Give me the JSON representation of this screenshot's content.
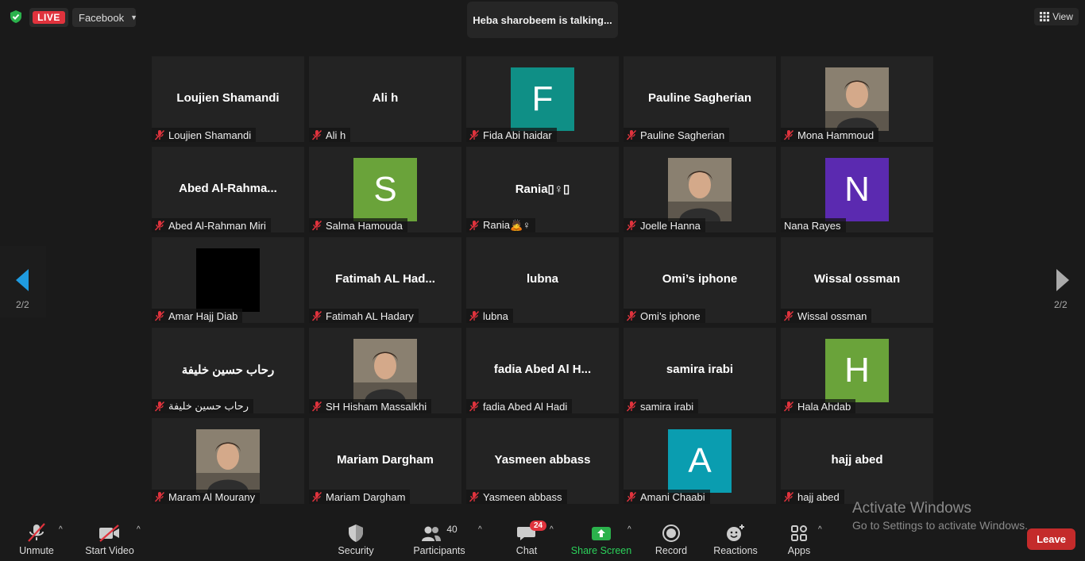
{
  "topbar": {
    "live_label": "LIVE",
    "stream_target": "Facebook",
    "talking": "Heba sharobeem is talking...",
    "view_label": "View"
  },
  "pagination": {
    "left": "2/2",
    "right": "2/2"
  },
  "colors": {
    "green": "#6aa33a",
    "purple": "#5b2ab0",
    "teal": "#0f8f86",
    "cyan": "#0a9db0",
    "live": "#e0333d",
    "share": "#2bb24c"
  },
  "participants": [
    {
      "display": "Loujien Shamandi",
      "label": "Loujien Shamandi",
      "type": "name"
    },
    {
      "display": "Ali h",
      "label": "Ali h",
      "type": "name"
    },
    {
      "display": "F",
      "label": "Fida Abi haidar",
      "type": "avatar",
      "color": "#0f8f86"
    },
    {
      "display": "Pauline Sagherian",
      "label": "Pauline Sagherian",
      "type": "name"
    },
    {
      "display": "",
      "label": "Mona Hammoud",
      "type": "photo"
    },
    {
      "display": "Abed  Al-Rahma...",
      "label": "Abed Al-Rahman Miri",
      "type": "name"
    },
    {
      "display": "S",
      "label": "Salma Hamouda",
      "type": "avatar",
      "color": "#6aa33a"
    },
    {
      "display": "Rania▯♀▯",
      "label": "Rania🙇♀",
      "type": "name"
    },
    {
      "display": "",
      "label": "Joelle Hanna",
      "type": "photo"
    },
    {
      "display": "N",
      "label": "Nana Rayes",
      "type": "avatar",
      "color": "#5b2ab0",
      "nomic": true
    },
    {
      "display": "",
      "label": "Amar Hajj Diab",
      "type": "black"
    },
    {
      "display": "Fatimah  AL  Had...",
      "label": "Fatimah AL Hadary",
      "type": "name"
    },
    {
      "display": "lubna",
      "label": "lubna",
      "type": "name"
    },
    {
      "display": "Omi’s iphone",
      "label": "Omi’s iphone",
      "type": "name"
    },
    {
      "display": "Wissal ossman",
      "label": "Wissal ossman",
      "type": "name"
    },
    {
      "display": "رحاب حسين خليفة",
      "label": "رحاب حسين خليفة",
      "type": "name"
    },
    {
      "display": "",
      "label": "SH Hisham Massalkhi",
      "type": "photo"
    },
    {
      "display": "fadia Abed Al H...",
      "label": "fadia Abed Al Hadi",
      "type": "name"
    },
    {
      "display": "samira irabi",
      "label": "samira irabi",
      "type": "name"
    },
    {
      "display": "H",
      "label": "Hala Ahdab",
      "type": "avatar",
      "color": "#6aa33a"
    },
    {
      "display": "",
      "label": "Maram Al Mourany",
      "type": "photo"
    },
    {
      "display": "Mariam Dargham",
      "label": "Mariam Dargham",
      "type": "name"
    },
    {
      "display": "Yasmeen abbass",
      "label": "Yasmeen abbass",
      "type": "name"
    },
    {
      "display": "A",
      "label": "Amani Chaabi",
      "type": "avatar",
      "color": "#0a9db0"
    },
    {
      "display": "hajj abed",
      "label": "hajj abed",
      "type": "name"
    }
  ],
  "toolbar": {
    "unmute": "Unmute",
    "start_video": "Start Video",
    "security": "Security",
    "participants": "Participants",
    "participants_count": "40",
    "chat": "Chat",
    "chat_badge": "24",
    "share_screen": "Share Screen",
    "record": "Record",
    "reactions": "Reactions",
    "apps": "Apps",
    "leave": "Leave"
  },
  "watermark": {
    "line1": "Activate Windows",
    "line2": "Go to Settings to activate Windows."
  }
}
